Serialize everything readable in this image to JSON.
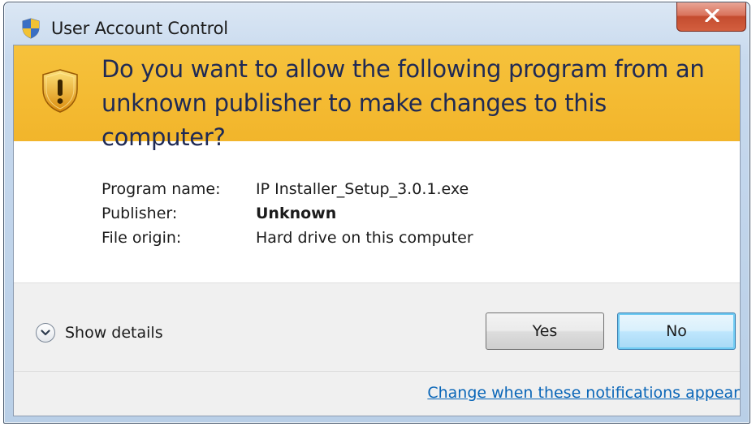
{
  "window": {
    "title": "User Account Control",
    "close_icon": "close-icon",
    "title_icon": "uac-shield-icon"
  },
  "banner": {
    "question": "Do you want to allow the following program from an unknown publisher to make changes to this computer?",
    "icon": "warning-shield-icon",
    "background_color": "#f3b72d",
    "text_color": "#1f2a55"
  },
  "info": {
    "rows": [
      {
        "label": "Program name:",
        "value": "IP Installer_Setup_3.0.1.exe",
        "bold": false
      },
      {
        "label": "Publisher:",
        "value": "Unknown",
        "bold": true
      },
      {
        "label": "File origin:",
        "value": "Hard drive on this computer",
        "bold": false
      }
    ]
  },
  "footer": {
    "details_label": "Show details",
    "details_icon": "chevron-down-icon",
    "yes_label": "Yes",
    "no_label": "No",
    "link_text": "Change when these notifications appear",
    "link_color": "#0a66b8"
  }
}
